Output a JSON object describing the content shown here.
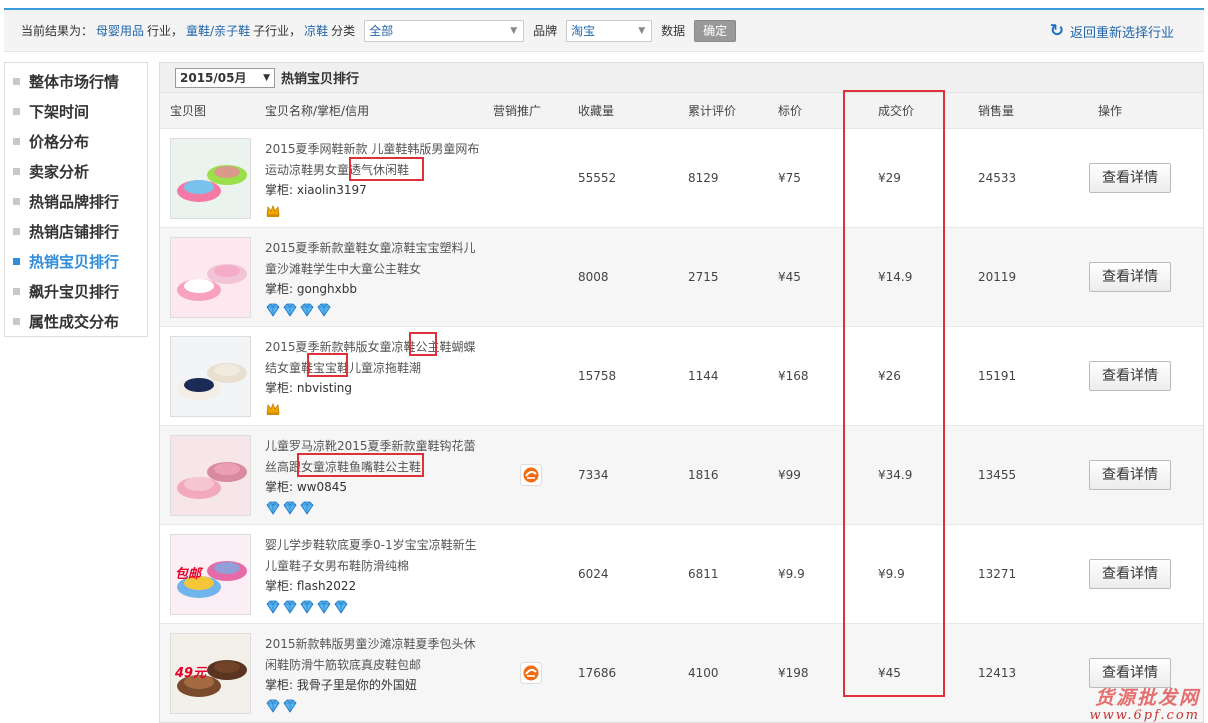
{
  "filter": {
    "prefix": "当前结果为：",
    "industry": "母婴用品",
    "industry_suffix": "行业，",
    "subindustry": "童鞋/亲子鞋",
    "subindustry_suffix": "子行业，",
    "category": "凉鞋",
    "category_suffix": "分类",
    "category_select": "全部",
    "brand_label": "品牌",
    "brand_select": "淘宝",
    "data_label": "数据",
    "confirm": "确定",
    "back": "返回重新选择行业"
  },
  "sidebar": {
    "items": [
      {
        "label": "整体市场行情"
      },
      {
        "label": "下架时间"
      },
      {
        "label": "价格分布"
      },
      {
        "label": "卖家分析"
      },
      {
        "label": "热销品牌排行"
      },
      {
        "label": "热销店铺排行"
      },
      {
        "label": "热销宝贝排行"
      },
      {
        "label": "飙升宝贝排行"
      },
      {
        "label": "属性成交分布"
      }
    ],
    "active_index": 6
  },
  "main": {
    "month": "2015/05月",
    "title": "热销宝贝排行",
    "columns": [
      "宝贝图",
      "宝贝名称/掌柜/信用",
      "营销推广",
      "收藏量",
      "累计评价",
      "标价",
      "成交价",
      "销售量",
      "操作"
    ],
    "shop_prefix": "掌柜: ",
    "detail_label": "查看详情",
    "rows": [
      {
        "name": "2015夏季网鞋新款 儿童鞋韩版男童网布运动凉鞋男女童透气休闲鞋",
        "shop": "xiaolin3197",
        "credit": "crown",
        "credit_count": 1,
        "promo": false,
        "fav": "55552",
        "reviews": "8129",
        "list_price": "¥75",
        "deal_price": "¥29",
        "sales": "24533"
      },
      {
        "name": "2015夏季新款童鞋女童凉鞋宝宝塑料儿童沙滩鞋学生中大童公主鞋女",
        "shop": "gonghxbb",
        "credit": "diamond",
        "credit_count": 4,
        "promo": false,
        "fav": "8008",
        "reviews": "2715",
        "list_price": "¥45",
        "deal_price": "¥14.9",
        "sales": "20119"
      },
      {
        "name": "2015夏季新款韩版女童凉鞋公主鞋蝴蝶结女童鞋宝宝鞋儿童凉拖鞋潮",
        "shop": "nbvisting",
        "credit": "crown",
        "credit_count": 1,
        "promo": false,
        "fav": "15758",
        "reviews": "1144",
        "list_price": "¥168",
        "deal_price": "¥26",
        "sales": "15191"
      },
      {
        "name": "儿童罗马凉靴2015夏季新款童鞋钩花蕾丝高跟女童凉鞋鱼嘴鞋公主鞋",
        "shop": "ww0845",
        "credit": "diamond",
        "credit_count": 3,
        "promo": true,
        "fav": "7334",
        "reviews": "1816",
        "list_price": "¥99",
        "deal_price": "¥34.9",
        "sales": "13455"
      },
      {
        "name": "婴儿学步鞋软底夏季0-1岁宝宝凉鞋新生儿童鞋子女男布鞋防滑纯棉",
        "shop": "flash2022",
        "credit": "diamond",
        "credit_count": 5,
        "promo": false,
        "fav": "6024",
        "reviews": "6811",
        "list_price": "¥9.9",
        "deal_price": "¥9.9",
        "sales": "13271",
        "thumb_text": "包邮"
      },
      {
        "name": "2015新款韩版男童沙滩凉鞋夏季包头休闲鞋防滑牛筋软底真皮鞋包邮",
        "shop": "我骨子里是你的外国妞",
        "credit": "diamond",
        "credit_count": 2,
        "promo": true,
        "fav": "17686",
        "reviews": "4100",
        "list_price": "¥198",
        "deal_price": "¥45",
        "sales": "12413",
        "thumb_text": "49元"
      }
    ]
  },
  "watermark": {
    "line1": "货源批发网",
    "line2": "www.6pf.com"
  },
  "colors": {
    "accent": "#2f8ddb",
    "highlight": "#e0303a",
    "link": "#2266aa"
  }
}
